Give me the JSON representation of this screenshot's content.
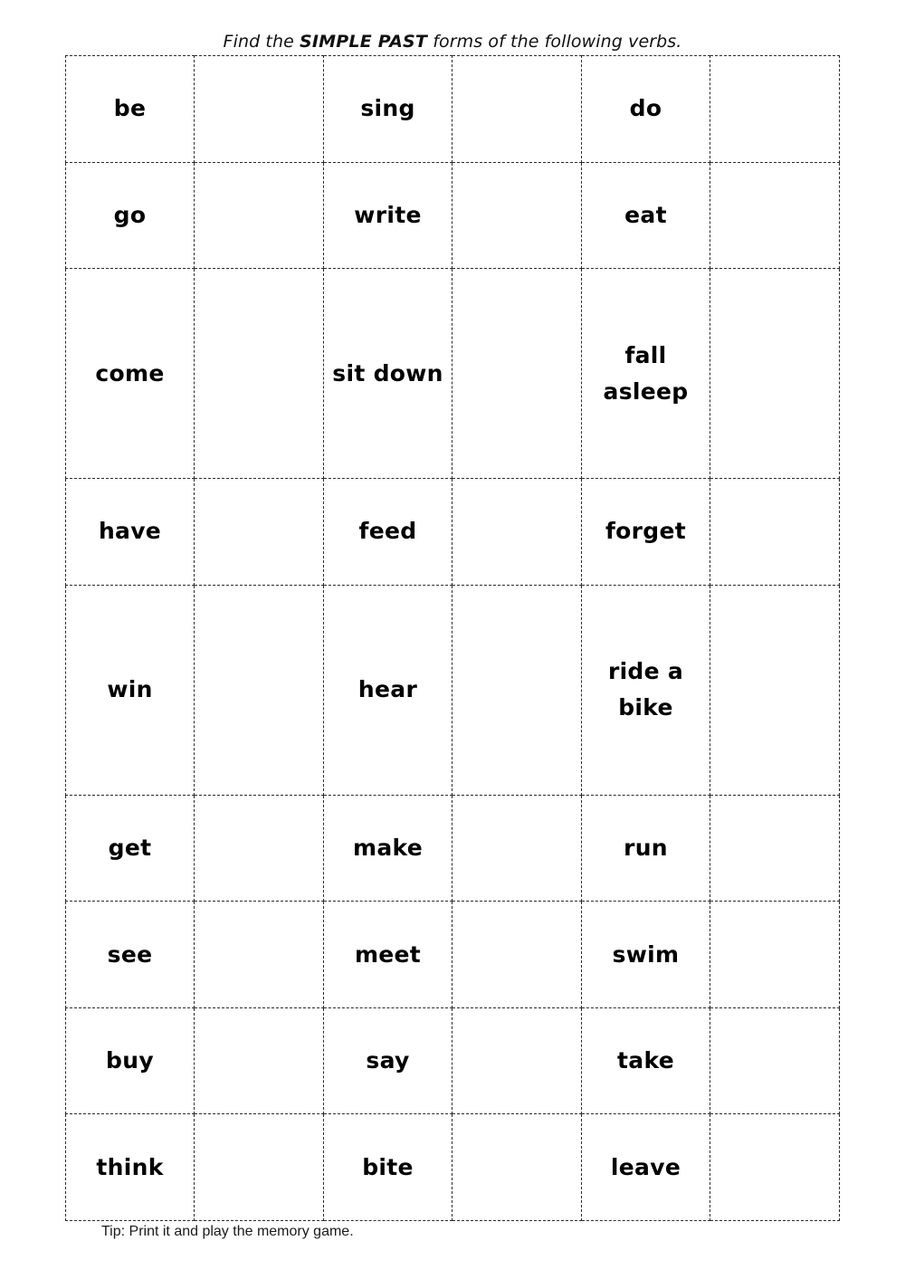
{
  "page": {
    "background_color": "#ffffff",
    "text_color": "#000000",
    "border_color": "#2b2b2b"
  },
  "title": {
    "prefix": "Find the ",
    "emphasis": "SIMPLE PAST",
    "suffix": " forms of the following verbs.",
    "full_text": "Find the SIMPLE PAST forms of the following verbs."
  },
  "table": {
    "column_count": 6,
    "row_count": 9,
    "border_style": "dashed",
    "pair_count_per_row": 3,
    "answer_placeholder": "",
    "rows": [
      {
        "pairs": [
          {
            "verb": "be"
          },
          {
            "verb": "sing"
          },
          {
            "verb": "do"
          }
        ]
      },
      {
        "pairs": [
          {
            "verb": "go"
          },
          {
            "verb": "write"
          },
          {
            "verb": "eat"
          }
        ]
      },
      {
        "pairs": [
          {
            "verb": "come"
          },
          {
            "verb": "sit down"
          },
          {
            "verb": "fall asleep"
          }
        ]
      },
      {
        "pairs": [
          {
            "verb": "have"
          },
          {
            "verb": "feed"
          },
          {
            "verb": "forget"
          }
        ]
      },
      {
        "pairs": [
          {
            "verb": "win"
          },
          {
            "verb": "hear"
          },
          {
            "verb": "ride a bike"
          }
        ]
      },
      {
        "pairs": [
          {
            "verb": "get"
          },
          {
            "verb": "make"
          },
          {
            "verb": "run"
          }
        ]
      },
      {
        "pairs": [
          {
            "verb": "see"
          },
          {
            "verb": "meet"
          },
          {
            "verb": "swim"
          }
        ]
      },
      {
        "pairs": [
          {
            "verb": "buy"
          },
          {
            "verb": "say"
          },
          {
            "verb": "take"
          }
        ]
      },
      {
        "pairs": [
          {
            "verb": "think"
          },
          {
            "verb": "bite"
          },
          {
            "verb": "leave"
          }
        ]
      }
    ]
  },
  "footer": {
    "tip": "Tip: Print it and play the memory game."
  }
}
